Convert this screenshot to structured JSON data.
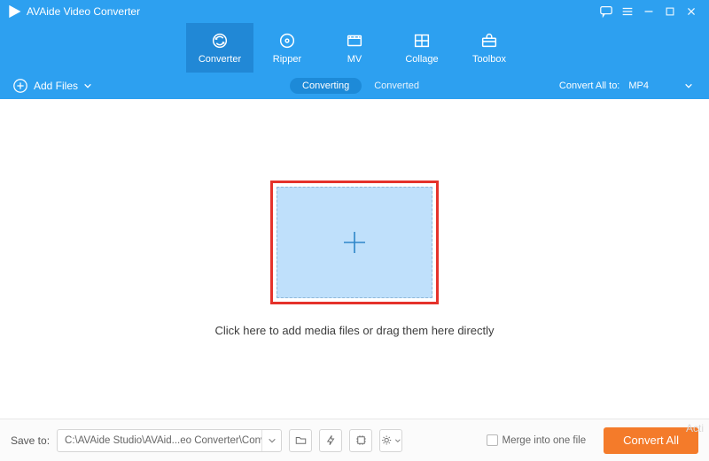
{
  "title": "AVAide Video Converter",
  "tabs": {
    "converter": "Converter",
    "ripper": "Ripper",
    "mv": "MV",
    "collage": "Collage",
    "toolbox": "Toolbox"
  },
  "toolrow": {
    "add_files": "Add Files",
    "converting": "Converting",
    "converted": "Converted",
    "convert_all_to_label": "Convert All to:",
    "format": "MP4"
  },
  "main": {
    "hint": "Click here to add media files or drag them here directly"
  },
  "bottom": {
    "save_to_label": "Save to:",
    "path": "C:\\AVAide Studio\\AVAid...eo Converter\\Converted",
    "merge_label": "Merge into one file",
    "convert_all_btn": "Convert All"
  },
  "watermark": "Acti"
}
